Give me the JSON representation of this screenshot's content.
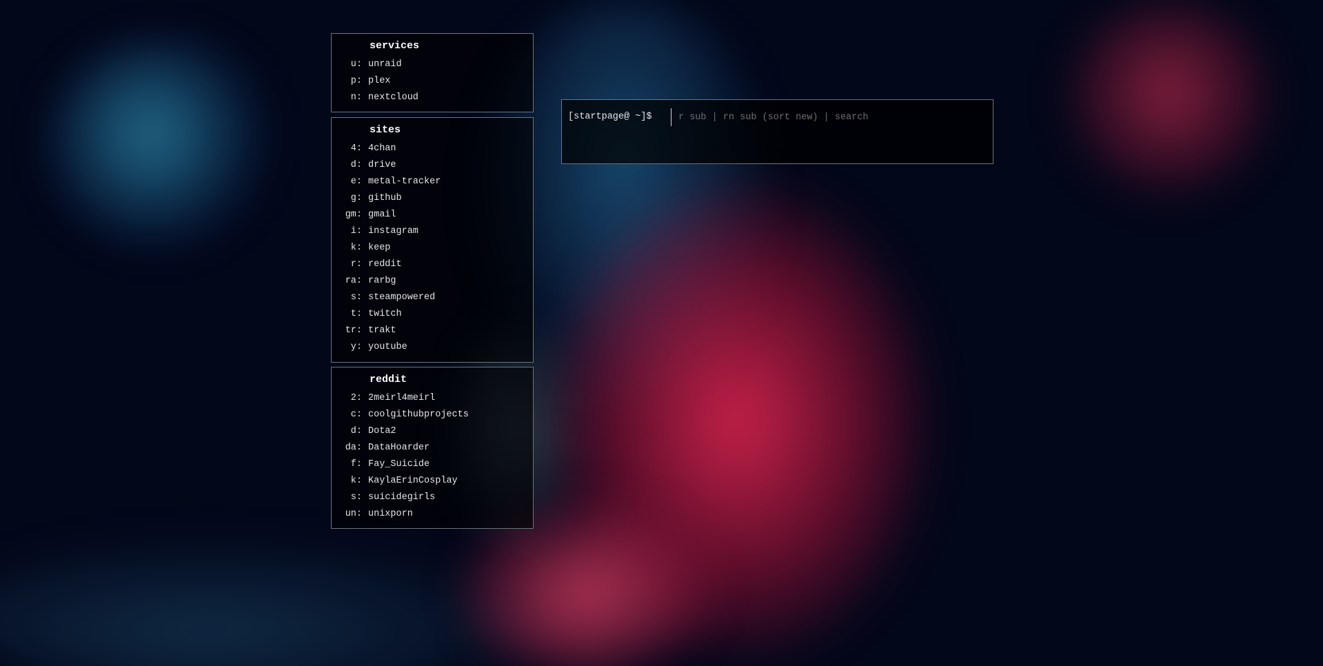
{
  "panels": [
    {
      "title": "services",
      "items": [
        {
          "key": "u:",
          "label": "unraid"
        },
        {
          "key": "p:",
          "label": "plex"
        },
        {
          "key": "n:",
          "label": "nextcloud"
        }
      ]
    },
    {
      "title": "sites",
      "items": [
        {
          "key": "4:",
          "label": "4chan"
        },
        {
          "key": "d:",
          "label": "drive"
        },
        {
          "key": "e:",
          "label": "metal-tracker"
        },
        {
          "key": "g:",
          "label": "github"
        },
        {
          "key": "gm:",
          "label": "gmail"
        },
        {
          "key": "i:",
          "label": "instagram"
        },
        {
          "key": "k:",
          "label": "keep"
        },
        {
          "key": "r:",
          "label": "reddit"
        },
        {
          "key": "ra:",
          "label": "rarbg"
        },
        {
          "key": "s:",
          "label": "steampowered"
        },
        {
          "key": "t:",
          "label": "twitch"
        },
        {
          "key": "tr:",
          "label": "trakt"
        },
        {
          "key": "y:",
          "label": "youtube"
        }
      ]
    },
    {
      "title": "reddit",
      "items": [
        {
          "key": "2:",
          "label": "2meirl4meirl"
        },
        {
          "key": "c:",
          "label": "coolgithubprojects"
        },
        {
          "key": "d:",
          "label": "Dota2"
        },
        {
          "key": "da:",
          "label": "DataHoarder"
        },
        {
          "key": "f:",
          "label": "Fay_Suicide"
        },
        {
          "key": "k:",
          "label": "KaylaErinCosplay"
        },
        {
          "key": "s:",
          "label": "suicidegirls"
        },
        {
          "key": "un:",
          "label": "unixporn"
        }
      ]
    }
  ],
  "terminal": {
    "prompt": "[startpage@ ~]$",
    "value": "",
    "placeholder": "r sub | rn sub (sort new) | search"
  }
}
